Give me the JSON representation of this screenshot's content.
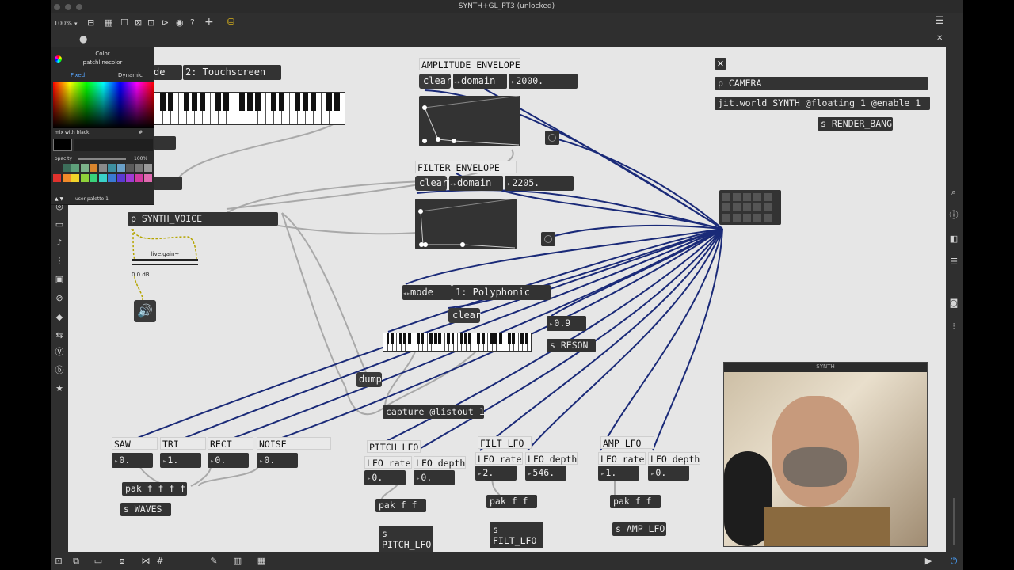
{
  "window": {
    "title": "SYNTH+GL_PT3 (unlocked)",
    "zoom": "100%"
  },
  "color_picker": {
    "header": "Color",
    "sub": "patchlinecolor",
    "tab_fixed": "Fixed",
    "tab_dynamic": "Dynamic",
    "mix": "mix with black",
    "hash": "#",
    "opacity_label": "opacity",
    "opacity_value": "100%",
    "palette": "user palette 1"
  },
  "patch": {
    "mode_menu_top": "2: Touchscreen",
    "mode_menu_top_partial": "de",
    "amp_env_title": "AMPLITUDE ENVELOPE",
    "amp_clear": "clear",
    "amp_domain": "domain",
    "amp_domain_value": "2000.",
    "filt_env_title": "FILTER ENVELOPE",
    "filt_clear": "clear",
    "filt_domain": "domain",
    "filt_domain_value": "2205.",
    "camera_obj": "p CAMERA",
    "jit_world": "jit.world SYNTH @floating 1 @enable 1",
    "render_bang": "s RENDER_BANG",
    "synth_voice": "p SYNTH_VOICE",
    "live_gain": "live.gain~",
    "gain_db": "0.0 dB",
    "mode_label": "mode",
    "mode_value": "1: Polyphonic",
    "clear2": "clear",
    "reson_num": "0.9",
    "reson_send": "s RESON",
    "dump": "dump",
    "capture": "capture @listout 1",
    "waves": {
      "labels": [
        "SAW",
        "TRI",
        "RECT",
        "NOISE"
      ],
      "values": [
        "0.",
        "1.",
        "0.",
        "0."
      ],
      "pak": "pak f f f f",
      "send": "s WAVES"
    },
    "pitch_lfo": {
      "title": "PITCH LFO",
      "rate_label": "LFO rate",
      "depth_label": "LFO depth",
      "rate": "0.",
      "depth": "0.",
      "pak": "pak f f",
      "send_line1": "s",
      "send_line2": "PITCH_LFO"
    },
    "filt_lfo": {
      "title": "FILT LFO",
      "rate_label": "LFO rate",
      "depth_label": "LFO depth",
      "rate": "2.",
      "depth": "546.",
      "pak": "pak f f",
      "send_line1": "s",
      "send_line2": "FILT_LFO"
    },
    "amp_lfo": {
      "title": "AMP LFO",
      "rate_label": "LFO rate",
      "depth_label": "LFO depth",
      "rate": "1.",
      "depth": "0.",
      "pak": "pak f f",
      "send": "s AMP_LFO"
    }
  },
  "synth_window": {
    "title": "SYNTH"
  },
  "colors": {
    "wire_blue": "#1a2a78",
    "wire_grey": "#a9a9a9",
    "canvas": "#e6e6e6",
    "object": "#333333"
  }
}
